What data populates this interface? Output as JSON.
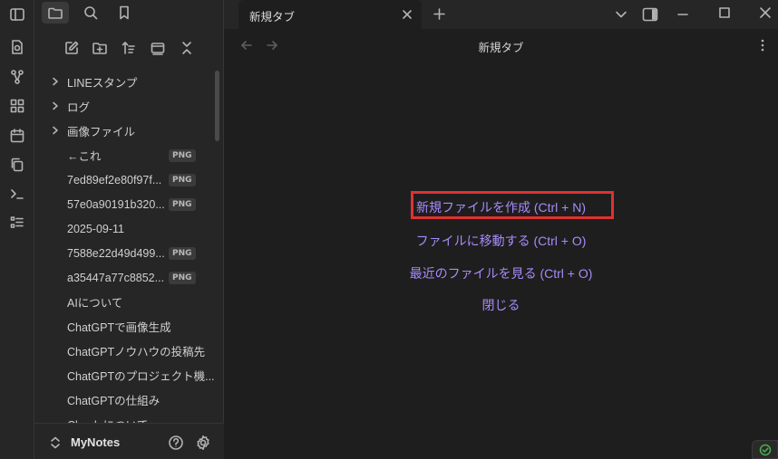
{
  "sidebar": {
    "files": [
      {
        "name": "LINEスタンプ",
        "folder": true,
        "badge": ""
      },
      {
        "name": "ログ",
        "folder": true,
        "badge": ""
      },
      {
        "name": "画像ファイル",
        "folder": true,
        "badge": ""
      },
      {
        "name": "←これ",
        "folder": false,
        "badge": "PNG"
      },
      {
        "name": "7ed89ef2e80f97f...",
        "folder": false,
        "badge": "PNG"
      },
      {
        "name": "57e0a90191b320...",
        "folder": false,
        "badge": "PNG"
      },
      {
        "name": "2025-09-11",
        "folder": false,
        "badge": ""
      },
      {
        "name": "7588e22d49d499...",
        "folder": false,
        "badge": "PNG"
      },
      {
        "name": "a35447a77c8852...",
        "folder": false,
        "badge": "PNG"
      },
      {
        "name": "AIについて",
        "folder": false,
        "badge": ""
      },
      {
        "name": "ChatGPTで画像生成",
        "folder": false,
        "badge": ""
      },
      {
        "name": "ChatGPTノウハウの投稿先",
        "folder": false,
        "badge": ""
      },
      {
        "name": "ChatGPTのプロジェクト機...",
        "folder": false,
        "badge": ""
      },
      {
        "name": "ChatGPTの仕組み",
        "folder": false,
        "badge": ""
      },
      {
        "name": "Claudeについて",
        "folder": false,
        "badge": ""
      }
    ],
    "vault_name": "MyNotes"
  },
  "tab": {
    "title": "新規タブ"
  },
  "view": {
    "title": "新規タブ"
  },
  "empty_state": {
    "create": "新規ファイルを作成 (Ctrl + N)",
    "goto": "ファイルに移動する (Ctrl + O)",
    "recent": "最近のファイルを見る (Ctrl + O)",
    "close": "閉じる"
  },
  "colors": {
    "accent": "#a78bfa",
    "highlight": "#e03131",
    "status_ok": "#4caf50"
  }
}
